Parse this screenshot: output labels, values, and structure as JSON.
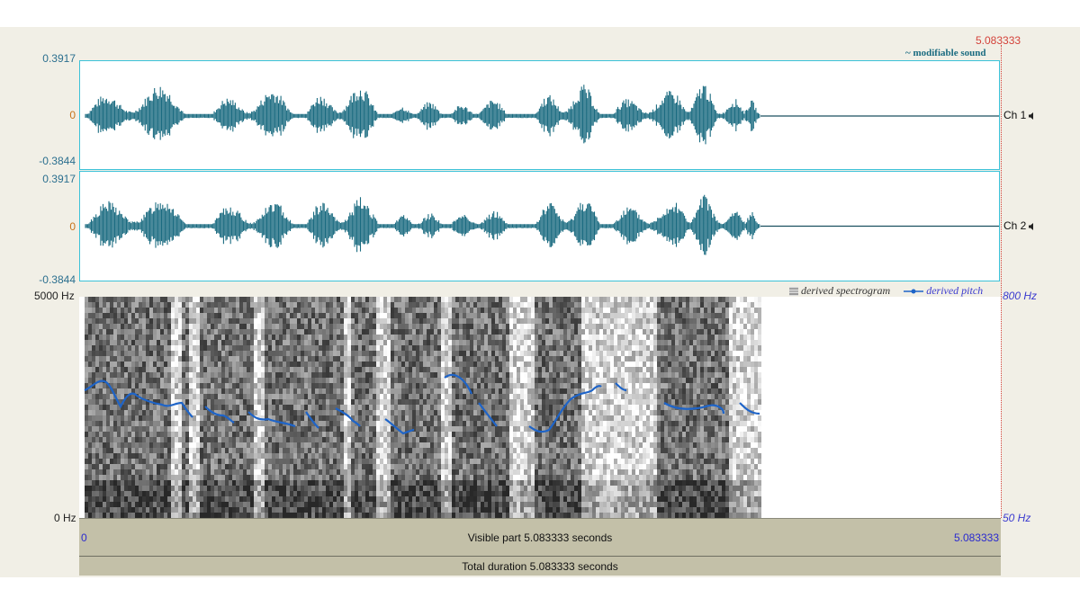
{
  "cursor_time": "5.083333",
  "modifiable_sound_label": "~ modifiable sound",
  "channels": [
    {
      "name": "Ch 1",
      "max": "0.3917",
      "zero": "0",
      "min": "-0.3844"
    },
    {
      "name": "Ch 2",
      "max": "0.3917",
      "zero": "0",
      "min": "-0.3844"
    }
  ],
  "spectrogram": {
    "freq_top": "5000 Hz",
    "freq_bottom": "0 Hz",
    "legend_spectrogram": "derived spectrogram",
    "legend_pitch": "derived pitch",
    "pitch_top": "800 Hz",
    "pitch_bottom": "50 Hz"
  },
  "time_axis": {
    "start": "0",
    "end": "5.083333",
    "visible_part": "Visible part 5.083333 seconds",
    "total_duration": "Total duration 5.083333 seconds"
  },
  "colors": {
    "waveform": "#1a6b80",
    "pitch": "#1e64c8",
    "panel_border": "#3cc2d8",
    "cursor_time": "#d4423a",
    "pitch_axis": "#3a3acf"
  }
}
